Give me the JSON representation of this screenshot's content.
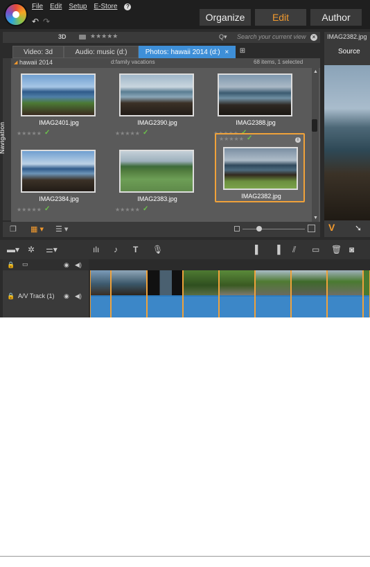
{
  "menu": {
    "file": "File",
    "edit": "Edit",
    "setup": "Setup",
    "estore": "E-Store"
  },
  "mode_tabs": {
    "organize": "Organize",
    "edit": "Edit",
    "author": "Author"
  },
  "library_header": {
    "three_d": "3D",
    "stars": "★★★★★",
    "search_placeholder": "Search your current view"
  },
  "tabs": [
    {
      "label": "Video: 3d"
    },
    {
      "label": "Audio: music (d:)"
    },
    {
      "label": "Photos: hawaii 2014 (d:)",
      "close": "×",
      "active": true
    }
  ],
  "navigation_label": "Navigation",
  "folder": {
    "name": "hawaii 2014",
    "path": "d:family vacations",
    "count": "68 items, 1 selected"
  },
  "photos": [
    {
      "filename": "IMAG2401.jpg",
      "rating": "★★★★★",
      "selected": false
    },
    {
      "filename": "IMAG2390.jpg",
      "rating": "★★★★★",
      "selected": false
    },
    {
      "filename": "IMAG2388.jpg",
      "rating": "★★★★★",
      "selected": false
    },
    {
      "filename": "IMAG2384.jpg",
      "rating": "★★★★★",
      "selected": false
    },
    {
      "filename": "IMAG2383.jpg",
      "rating": "★★★★★",
      "selected": false
    },
    {
      "filename": "IMAG2382.jpg",
      "rating": "★★★★★",
      "selected": true
    }
  ],
  "preview": {
    "title": "IMAG2382.jpg",
    "source_label": "Source",
    "v_label": "V"
  },
  "timeline": {
    "track_label": "A/V Track (1)"
  },
  "colors": {
    "accent_orange": "#f29a2e",
    "tab_blue": "#3e8fd8",
    "check_green": "#6cc24a",
    "track_blue": "#2c7bbf"
  },
  "icons": [
    "undo-icon",
    "redo-icon",
    "help-icon",
    "clear-search-icon",
    "grid-view-icon",
    "list-view-icon",
    "zoom-slider",
    "eye-icon",
    "speaker-icon",
    "lock-icon",
    "text-tool-icon",
    "mic-icon",
    "trash-icon",
    "camera-icon"
  ]
}
